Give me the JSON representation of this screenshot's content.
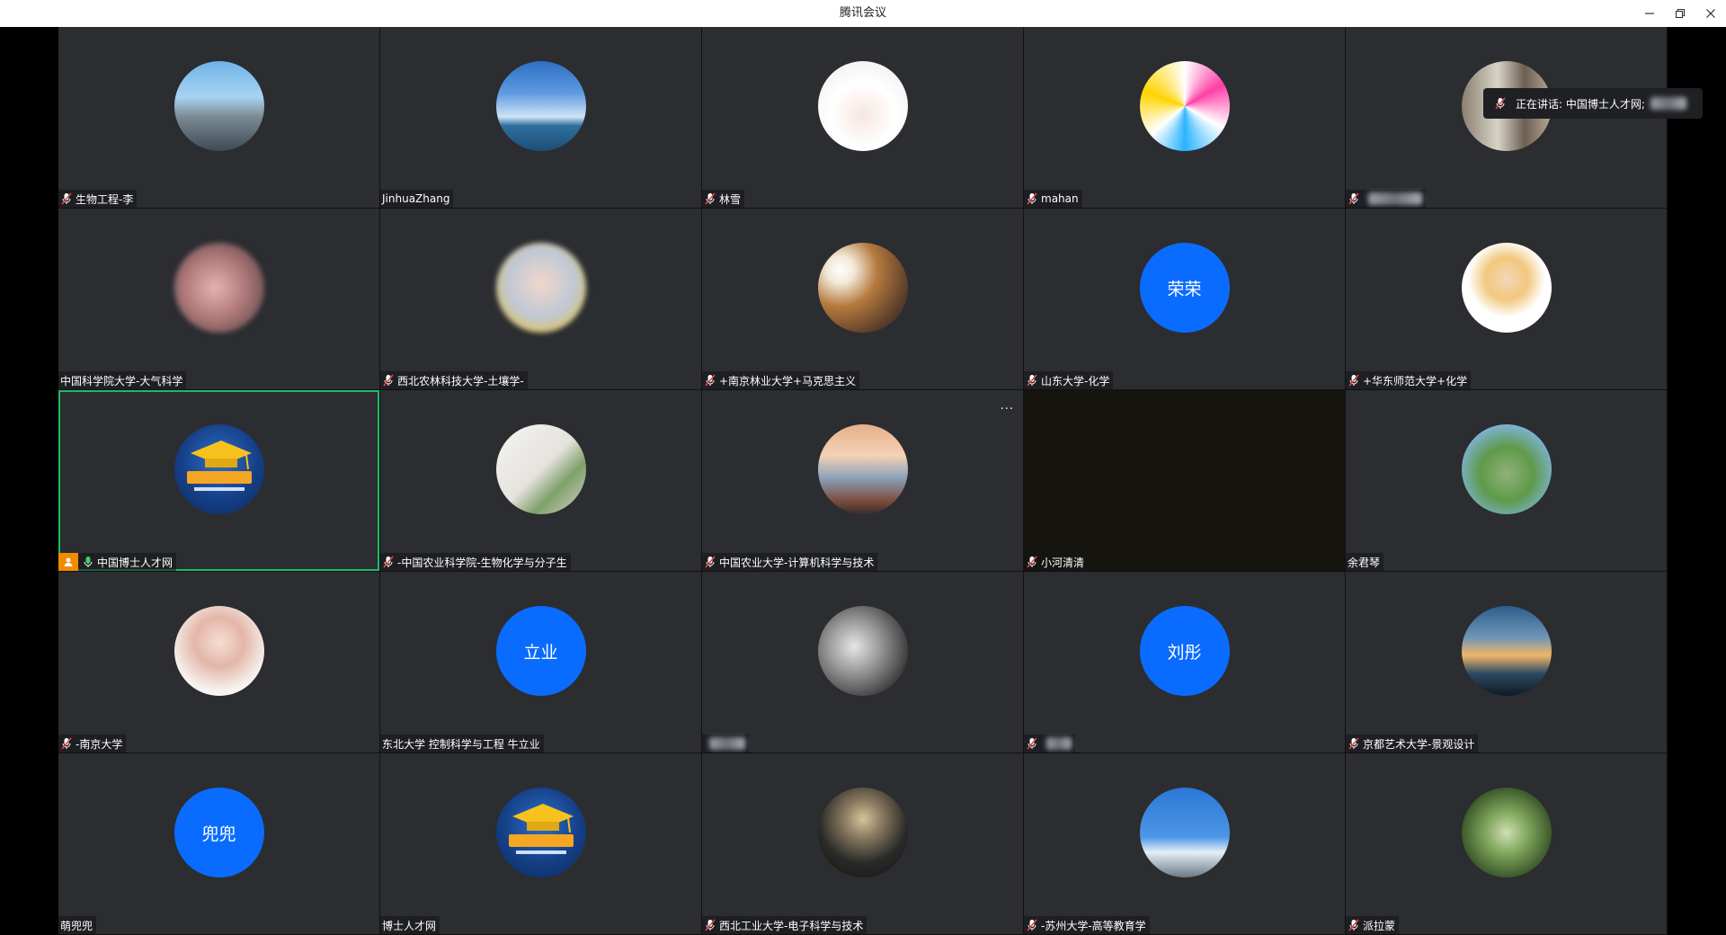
{
  "window": {
    "title": "腾讯会议"
  },
  "speaking": {
    "label": "正在讲话: 中国博士人才网;"
  },
  "tiles": [
    {
      "name": "生物工程-李",
      "mic": true
    },
    {
      "name": "JinhuaZhang",
      "mic": false
    },
    {
      "name": "林雪",
      "mic": true
    },
    {
      "name": "mahan",
      "mic": true
    },
    {
      "name": "",
      "mic": true
    },
    {
      "name": "中国科学院大学-大气科学",
      "mic": false
    },
    {
      "name": "西北农林科技大学-土壤学-",
      "mic": true
    },
    {
      "name": "+南京林业大学+马克思主义",
      "mic": true
    },
    {
      "name": "山东大学-化学",
      "mic": true,
      "avatar_text": "荣荣"
    },
    {
      "name": "+华东师范大学+化学",
      "mic": true
    },
    {
      "name": "中国博士人才网",
      "mic": true,
      "host": true,
      "active": true
    },
    {
      "name": "-中国农业科学院-生物化学与分子生",
      "mic": true
    },
    {
      "name": "中国农业大学-计算机科学与技术",
      "mic": true,
      "more": "..."
    },
    {
      "name": "小河清清",
      "mic": true,
      "dark": true
    },
    {
      "name": "余君琴",
      "mic": false
    },
    {
      "name": "-南京大学",
      "mic": true
    },
    {
      "name": "东北大学 控制科学与工程 牛立业",
      "mic": false,
      "avatar_text": "立业"
    },
    {
      "name": "",
      "mic": false
    },
    {
      "name": "",
      "mic": true,
      "avatar_text": "刘彤"
    },
    {
      "name": "京都艺术大学-景观设计",
      "mic": true
    },
    {
      "name": "萌兜兜",
      "mic": false,
      "avatar_text": "兜兜"
    },
    {
      "name": "博士人才网",
      "mic": false
    },
    {
      "name": "西北工业大学-电子科学与技术",
      "mic": true
    },
    {
      "name": "-苏州大学-高等教育学",
      "mic": true
    },
    {
      "name": "派拉蒙",
      "mic": true
    }
  ]
}
